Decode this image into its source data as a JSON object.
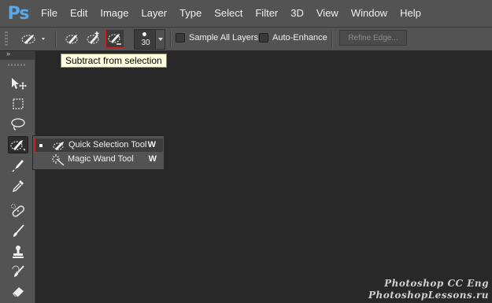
{
  "app": {
    "logo": "Ps"
  },
  "menubar": {
    "items": [
      "File",
      "Edit",
      "Image",
      "Layer",
      "Type",
      "Select",
      "Filter",
      "3D",
      "View",
      "Window",
      "Help"
    ]
  },
  "options": {
    "tool_preset_icon": "quick-selection-icon",
    "modes": [
      {
        "name": "new-selection",
        "icon": "quick-selection-icon"
      },
      {
        "name": "add-to-selection",
        "icon": "quick-selection-add-icon"
      },
      {
        "name": "subtract-from-selection",
        "icon": "quick-selection-subtract-icon",
        "active": true
      }
    ],
    "brush_size": "30",
    "sample_all_layers_label": "Sample All Layers",
    "sample_all_layers_checked": false,
    "auto_enhance_label": "Auto-Enhance",
    "auto_enhance_checked": false,
    "refine_edge_label": "Refine Edge...",
    "refine_edge_enabled": false
  },
  "tooltip": {
    "text": "Subtract from selection"
  },
  "toolbar": {
    "collapse_glyph": "»",
    "tools": [
      {
        "name": "move-tool",
        "icon": "move-icon"
      },
      {
        "name": "rectangular-marquee-tool",
        "icon": "marquee-icon"
      },
      {
        "name": "lasso-tool",
        "icon": "lasso-icon"
      },
      {
        "name": "quick-selection-tool",
        "icon": "quick-selection-icon",
        "selected": true
      },
      {
        "name": "crop-tool",
        "icon": "crop-icon"
      },
      {
        "name": "eyedropper-tool",
        "icon": "eyedropper-icon"
      },
      {
        "name": "spot-healing-tool",
        "icon": "bandage-icon"
      },
      {
        "name": "brush-tool",
        "icon": "brush-icon"
      },
      {
        "name": "clone-stamp-tool",
        "icon": "stamp-icon"
      },
      {
        "name": "history-brush-tool",
        "icon": "history-brush-icon"
      },
      {
        "name": "eraser-tool",
        "icon": "eraser-icon"
      }
    ]
  },
  "flyout": {
    "items": [
      {
        "label": "Quick Selection Tool",
        "shortcut": "W",
        "active": true,
        "icon": "quick-selection-icon"
      },
      {
        "label": "Magic Wand Tool",
        "shortcut": "W",
        "active": false,
        "icon": "magic-wand-icon"
      }
    ]
  },
  "watermark": {
    "line1": "Photoshop CC Eng",
    "line2": "PhotoshopLessons.ru"
  },
  "colors": {
    "accent_red": "#cc2020",
    "tooltip_bg": "#ffffe0",
    "ps_blue": "#5aa8e8"
  }
}
